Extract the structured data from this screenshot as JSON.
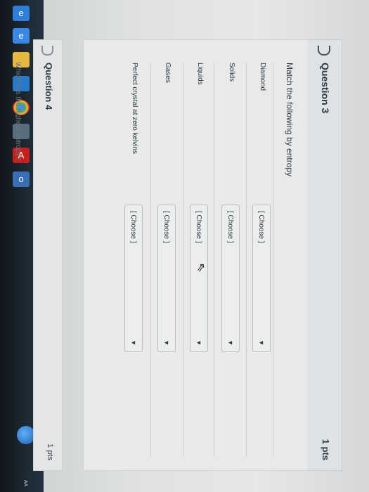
{
  "question3": {
    "title": "Question 3",
    "points": "1 pts",
    "prompt": "Match the following by entropy",
    "rows": [
      {
        "label": "Diamond",
        "selected": "[ Choose ]"
      },
      {
        "label": "Solids",
        "selected": "[ Choose ]"
      },
      {
        "label": "Liquids",
        "selected": "[ Choose ]"
      },
      {
        "label": "Gases",
        "selected": "[ Choose ]"
      },
      {
        "label": "Perfect crystal at zero kelvins",
        "selected": "[ Choose ]"
      }
    ]
  },
  "question4": {
    "title": "Question 4",
    "points": "1 pts",
    "prompt": "Which has the highest entropy?"
  },
  "icons": {
    "dropdown_arrow": "▼",
    "cursor": "⇖"
  },
  "taskbar": {
    "tray_text": "ᴬᴬ"
  }
}
